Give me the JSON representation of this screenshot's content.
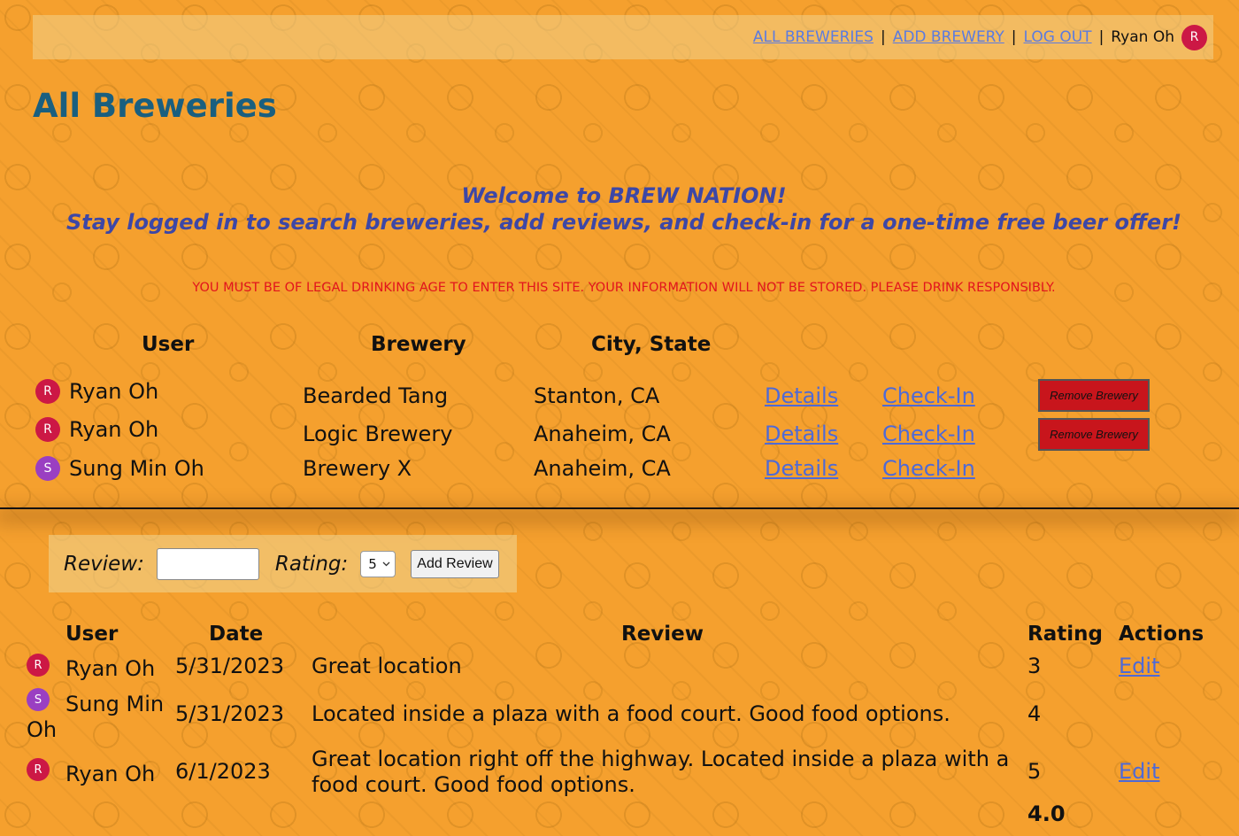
{
  "nav": {
    "all_breweries": "ALL BREWERIES",
    "add_brewery": "ADD BREWERY",
    "log_out": "LOG OUT",
    "separator": "|",
    "user_name": "Ryan Oh",
    "user_initial": "R"
  },
  "page_title": "All Breweries",
  "welcome": {
    "line1": "Welcome to BREW NATION!",
    "line2": "Stay logged in to search breweries, add reviews, and check-in for a one-time free beer offer!"
  },
  "legal_notice": "YOU MUST BE OF LEGAL DRINKING AGE TO ENTER THIS SITE. YOUR INFORMATION WILL NOT BE STORED. PLEASE DRINK RESPONSIBLY.",
  "breweries": {
    "headers": {
      "user": "User",
      "brewery": "Brewery",
      "city_state": "City, State"
    },
    "rows": [
      {
        "initial": "R",
        "user": "Ryan Oh",
        "brewery": "Bearded Tang",
        "city_state": "Stanton, CA",
        "details": "Details",
        "checkin": "Check-In",
        "remove": "Remove Brewery"
      },
      {
        "initial": "R",
        "user": "Ryan Oh",
        "brewery": "Logic Brewery",
        "city_state": "Anaheim, CA",
        "details": "Details",
        "checkin": "Check-In",
        "remove": "Remove Brewery"
      },
      {
        "initial": "S",
        "user": "Sung Min Oh",
        "brewery": "Brewery X",
        "city_state": "Anaheim, CA",
        "details": "Details",
        "checkin": "Check-In"
      }
    ]
  },
  "review_form": {
    "review_label": "Review:",
    "review_value": "",
    "rating_label": "Rating:",
    "rating_selected": "5",
    "submit_label": "Add Review"
  },
  "reviews": {
    "headers": {
      "user": "User",
      "date": "Date",
      "review": "Review",
      "rating": "Rating",
      "actions": "Actions"
    },
    "rows": [
      {
        "initial": "R",
        "user": "Ryan Oh",
        "date": "5/31/2023",
        "review": "Great location",
        "rating": "3",
        "action": "Edit"
      },
      {
        "initial": "S",
        "user_line1": "Sung Min",
        "user_line2": "Oh",
        "date": "5/31/2023",
        "review": "Located inside a plaza with a food court. Good food options.",
        "rating": "4"
      },
      {
        "initial": "R",
        "user": "Ryan Oh",
        "date": "6/1/2023",
        "review_line1": "Great location right off the highway. Located inside a plaza with a",
        "review_line2": "food court. Good food options.",
        "rating": "5",
        "action": "Edit"
      }
    ],
    "average_rating": "4.0"
  },
  "colors": {
    "background": "#f5a02e",
    "title": "#1a5f7f",
    "welcome": "#3d47a6",
    "legal": "#e2141d",
    "link": "#4f6ad6",
    "remove_button": "#c8151c",
    "avatar_r": "#cc1845",
    "avatar_s": "#9a3fc2"
  }
}
